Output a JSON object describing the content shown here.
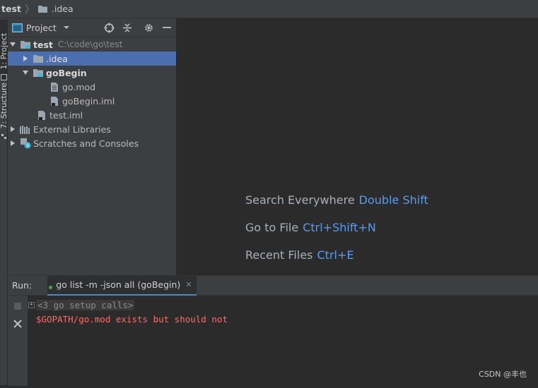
{
  "navbar": {
    "project": "test",
    "folder": ".idea"
  },
  "left_strip": {
    "project_tab": "1: Project",
    "structure_tab": "7: Structure"
  },
  "project_panel": {
    "title": "Project",
    "tree": [
      {
        "label": "test",
        "path": "C:\\code\\go\\test"
      },
      {
        "label": ".idea"
      },
      {
        "label": "goBegin"
      },
      {
        "label": "go.mod"
      },
      {
        "label": "goBegin.iml"
      },
      {
        "label": "test.iml"
      },
      {
        "label": "External Libraries"
      },
      {
        "label": "Scratches and Consoles"
      }
    ]
  },
  "editor": {
    "hints": [
      {
        "label": "Search Everywhere",
        "shortcut": "Double Shift"
      },
      {
        "label": "Go to File",
        "shortcut": "Ctrl+Shift+N"
      },
      {
        "label": "Recent Files",
        "shortcut": "Ctrl+E"
      }
    ]
  },
  "run_panel": {
    "label": "Run:",
    "tab_label": "go list -m -json all (goBegin)",
    "console": {
      "folded": "<3 go setup calls>",
      "error": "$GOPATH/go.mod exists but should not"
    }
  },
  "watermark": "CSDN @丰也",
  "colors": {
    "selection": "#4b6eaf",
    "accent": "#5a9cf0",
    "error": "#ff6b68",
    "panel": "#3c3f41",
    "editor": "#2b2b2b"
  }
}
